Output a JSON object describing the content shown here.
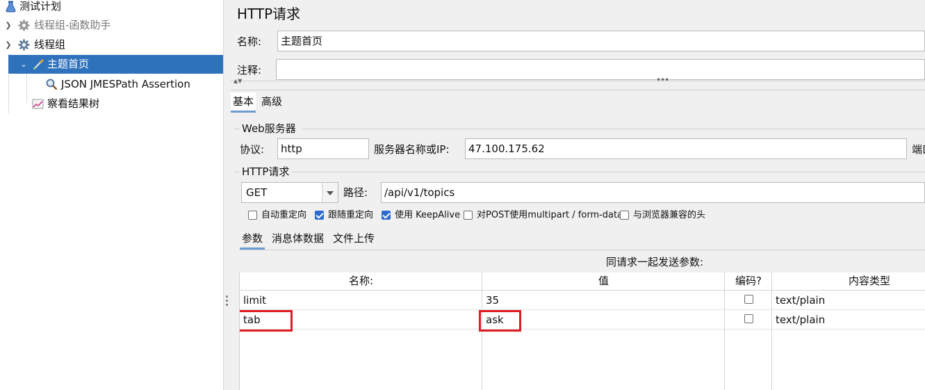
{
  "tree": {
    "items": [
      {
        "label": "测试计划"
      },
      {
        "label": "线程组-函数助手"
      },
      {
        "label": "线程组"
      },
      {
        "label": "主题首页"
      },
      {
        "label": "JSON JMESPath Assertion"
      },
      {
        "label": "察看结果树"
      }
    ]
  },
  "panel": {
    "title": "HTTP请求",
    "name_label": "名称:",
    "name_value": "主题首页",
    "comment_label": "注释:",
    "comment_value": "",
    "tabs": [
      "基本",
      "高级"
    ],
    "web_server": {
      "group_label": "Web服务器",
      "protocol_label": "协议:",
      "protocol_value": "http",
      "server_label": "服务器名称或IP:",
      "server_value": "47.100.175.62",
      "port_label_partial": "端口"
    },
    "http_request": {
      "group_label": "HTTP请求",
      "method": "GET",
      "path_label": "路径:",
      "path_value": "/api/v1/topics"
    },
    "options": [
      {
        "label": "自动重定向",
        "checked": false
      },
      {
        "label": "跟随重定向",
        "checked": true
      },
      {
        "label": "使用 KeepAlive",
        "checked": true
      },
      {
        "label": "对POST使用multipart / form-data",
        "checked": false
      },
      {
        "label": "与浏览器兼容的头",
        "checked": false
      }
    ],
    "sub_tabs": [
      "参数",
      "消息体数据",
      "文件上传"
    ],
    "params_caption": "同请求一起发送参数:",
    "table": {
      "headers": [
        "名称:",
        "值",
        "编码?",
        "内容类型"
      ],
      "rows": [
        {
          "name": "limit",
          "value": "35",
          "encode": false,
          "content_type": "text/plain"
        },
        {
          "name": "tab",
          "value": "ask",
          "encode": false,
          "content_type": "text/plain"
        }
      ]
    }
  },
  "colors": {
    "selection": "#2f72bc",
    "highlight_box": "#e01b24",
    "checkbox_checked": "#2d6bd0"
  }
}
